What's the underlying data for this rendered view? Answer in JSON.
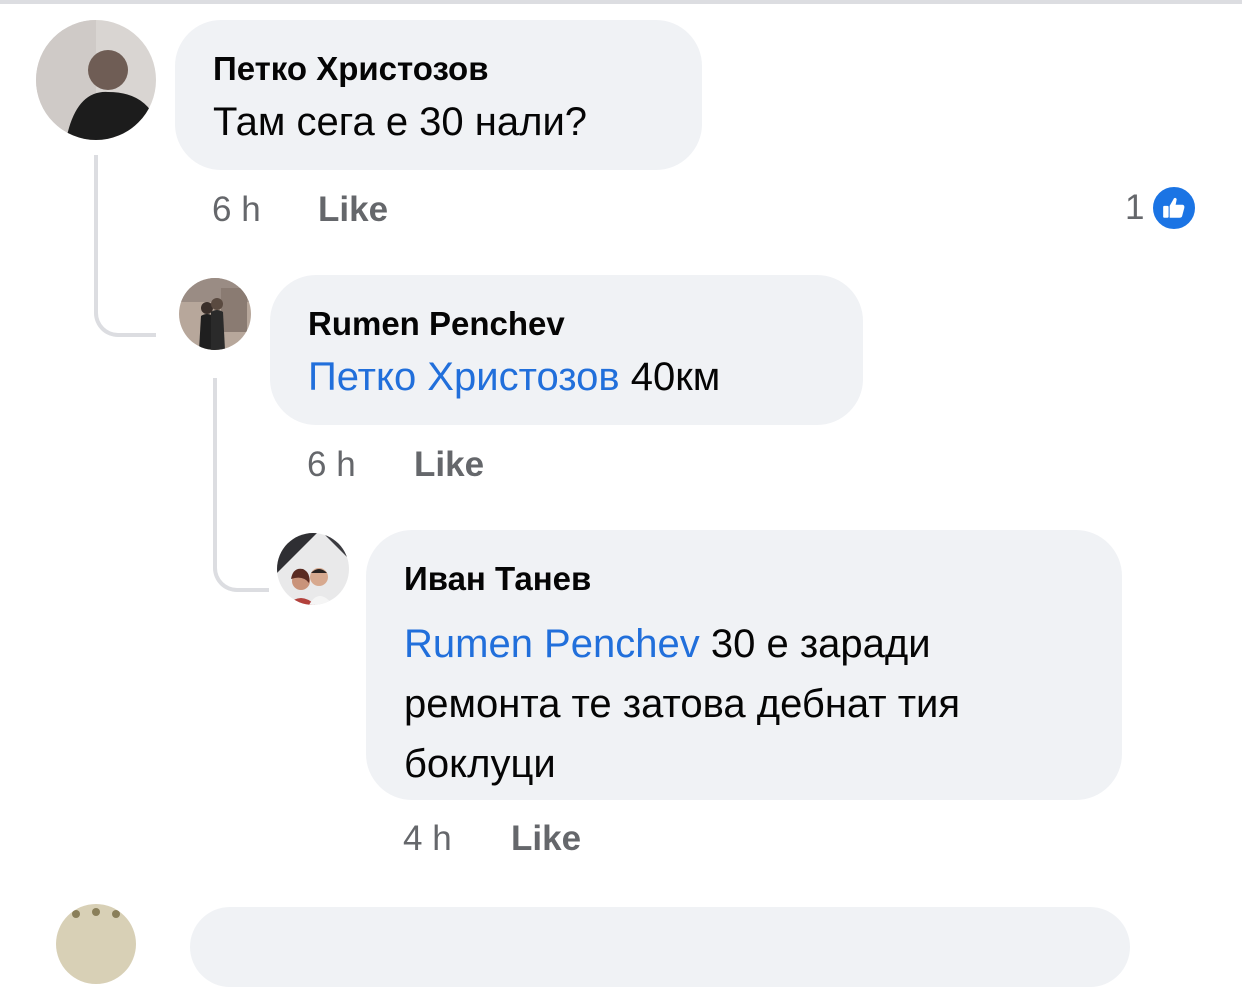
{
  "comments": [
    {
      "author": "Петко Христозов",
      "text": "Там сега е 30 нали?",
      "time": "6 h",
      "like_label": "Like",
      "reaction_count": "1",
      "reaction_icon": "thumbs-up-icon"
    },
    {
      "author": "Rumen Penchev",
      "mention": "Петко Христозов",
      "text": " 40км",
      "time": "6 h",
      "like_label": "Like"
    },
    {
      "author": "Иван Танев",
      "mention": "Rumen Penchev",
      "text_line1": " 30 е заради",
      "text_line2": "ремонта те затова дебнат тия",
      "text_line3": "боклуци",
      "time": "4 h",
      "like_label": "Like"
    }
  ],
  "colors": {
    "bubble": "#f0f2f5",
    "mention": "#216fdb",
    "meta": "#65676b",
    "like_badge": "#1b74e4"
  }
}
